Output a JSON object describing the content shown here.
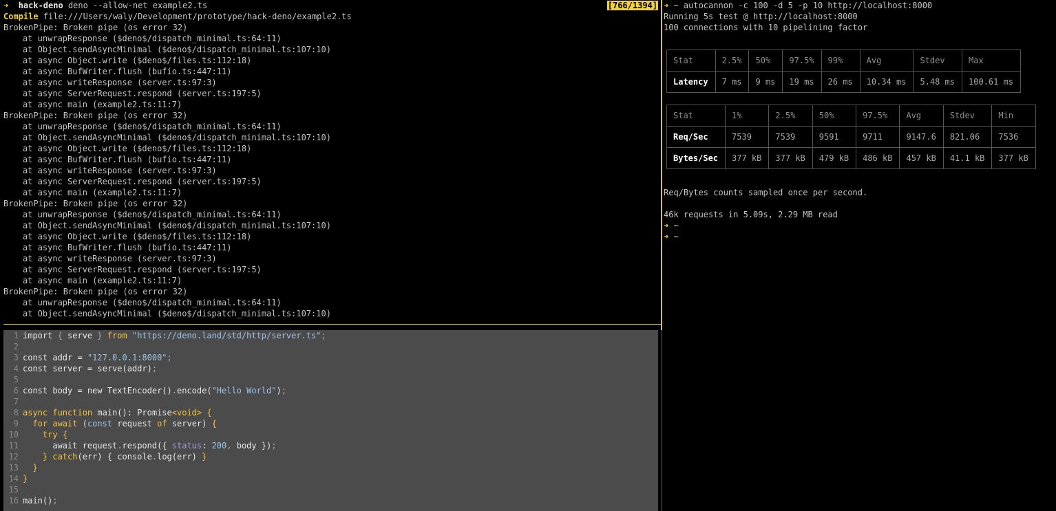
{
  "log_pane": {
    "prompt_symbol": "➜",
    "prompt_dir": "hack-deno",
    "command": "deno --allow-net example2.ts",
    "scroll_position": "[766/1394]",
    "compile_label": "Compile",
    "compile_path": "file:///Users/waly/Development/prototype/hack-deno/example2.ts",
    "lines": [
      {
        "text": "BrokenPipe: Broken pipe (os error 32)",
        "indent": false
      },
      {
        "text": "at unwrapResponse ($deno$/dispatch_minimal.ts:64:11)",
        "indent": true
      },
      {
        "text": "at Object.sendAsyncMinimal ($deno$/dispatch_minimal.ts:107:10)",
        "indent": true
      },
      {
        "text": "at async Object.write ($deno$/files.ts:112:18)",
        "indent": true
      },
      {
        "text": "at async BufWriter.flush (bufio.ts:447:11)",
        "indent": true
      },
      {
        "text": "at async writeResponse (server.ts:97:3)",
        "indent": true
      },
      {
        "text": "at async ServerRequest.respond (server.ts:197:5)",
        "indent": true
      },
      {
        "text": "at async main (example2.ts:11:7)",
        "indent": true
      },
      {
        "text": "BrokenPipe: Broken pipe (os error 32)",
        "indent": false
      },
      {
        "text": "at unwrapResponse ($deno$/dispatch_minimal.ts:64:11)",
        "indent": true
      },
      {
        "text": "at Object.sendAsyncMinimal ($deno$/dispatch_minimal.ts:107:10)",
        "indent": true
      },
      {
        "text": "at async Object.write ($deno$/files.ts:112:18)",
        "indent": true
      },
      {
        "text": "at async BufWriter.flush (bufio.ts:447:11)",
        "indent": true
      },
      {
        "text": "at async writeResponse (server.ts:97:3)",
        "indent": true
      },
      {
        "text": "at async ServerRequest.respond (server.ts:197:5)",
        "indent": true
      },
      {
        "text": "at async main (example2.ts:11:7)",
        "indent": true
      },
      {
        "text": "BrokenPipe: Broken pipe (os error 32)",
        "indent": false
      },
      {
        "text": "at unwrapResponse ($deno$/dispatch_minimal.ts:64:11)",
        "indent": true
      },
      {
        "text": "at Object.sendAsyncMinimal ($deno$/dispatch_minimal.ts:107:10)",
        "indent": true
      },
      {
        "text": "at async Object.write ($deno$/files.ts:112:18)",
        "indent": true
      },
      {
        "text": "at async BufWriter.flush (bufio.ts:447:11)",
        "indent": true
      },
      {
        "text": "at async writeResponse (server.ts:97:3)",
        "indent": true
      },
      {
        "text": "at async ServerRequest.respond (server.ts:197:5)",
        "indent": true
      },
      {
        "text": "at async main (example2.ts:11:7)",
        "indent": true
      },
      {
        "text": "BrokenPipe: Broken pipe (os error 32)",
        "indent": false
      },
      {
        "text": "at unwrapResponse ($deno$/dispatch_minimal.ts:64:11)",
        "indent": true
      },
      {
        "text": "at Object.sendAsyncMinimal ($deno$/dispatch_minimal.ts:107:10)",
        "indent": true
      }
    ]
  },
  "editor": {
    "lines": [
      {
        "n": "1",
        "tokens": [
          [
            "kw0",
            "import "
          ],
          [
            "sym",
            "{ "
          ],
          [
            "code",
            "serve "
          ],
          [
            "sym",
            "} "
          ],
          [
            "kw",
            "from "
          ],
          [
            "str",
            "\"https://deno.land/std/http/server.ts\""
          ],
          [
            "sym",
            ";"
          ]
        ]
      },
      {
        "n": "2",
        "tokens": []
      },
      {
        "n": "3",
        "tokens": [
          [
            "code",
            "const addr = "
          ],
          [
            "str",
            "\"127.0.0.1:8000\""
          ],
          [
            "sym",
            ";"
          ]
        ]
      },
      {
        "n": "4",
        "tokens": [
          [
            "code",
            "const server = serve(addr)"
          ],
          [
            "sym",
            ";"
          ]
        ]
      },
      {
        "n": "5",
        "tokens": []
      },
      {
        "n": "6",
        "tokens": [
          [
            "code",
            "const body = "
          ],
          [
            "code",
            "new "
          ],
          [
            "code",
            "TextEncoder()"
          ],
          [
            "sym",
            "."
          ],
          [
            "code",
            "encode("
          ],
          [
            "str",
            "\"Hello World\""
          ],
          [
            "code",
            ")"
          ],
          [
            "sym",
            ";"
          ]
        ]
      },
      {
        "n": "7",
        "tokens": []
      },
      {
        "n": "8",
        "tokens": [
          [
            "kw",
            "async "
          ],
          [
            "kw",
            "function "
          ],
          [
            "code",
            "main(): Promise"
          ],
          [
            "kw",
            "<void> "
          ],
          [
            "kw",
            "{"
          ]
        ]
      },
      {
        "n": "9",
        "tokens": [
          [
            "code",
            "  "
          ],
          [
            "kw",
            "for "
          ],
          [
            "kw",
            "await "
          ],
          [
            "code",
            "("
          ],
          [
            "str",
            "const "
          ],
          [
            "code",
            "request "
          ],
          [
            "kw",
            "of "
          ],
          [
            "code",
            "server) "
          ],
          [
            "kw",
            "{"
          ]
        ]
      },
      {
        "n": "10",
        "tokens": [
          [
            "code",
            "    "
          ],
          [
            "kw",
            "try "
          ],
          [
            "kw",
            "{"
          ]
        ]
      },
      {
        "n": "11",
        "tokens": [
          [
            "code",
            "      await request"
          ],
          [
            "sym",
            "."
          ],
          [
            "code",
            "respond({ "
          ],
          [
            "prop",
            "status"
          ],
          [
            "code",
            ": "
          ],
          [
            "num",
            "200"
          ],
          [
            "sym",
            ", "
          ],
          [
            "code",
            "body })"
          ],
          [
            "sym",
            ";"
          ]
        ]
      },
      {
        "n": "12",
        "tokens": [
          [
            "code",
            "    "
          ],
          [
            "kw",
            "} "
          ],
          [
            "kw",
            "catch"
          ],
          [
            "code",
            "(err) { console"
          ],
          [
            "sym",
            "."
          ],
          [
            "code",
            "log(err) "
          ],
          [
            "kw",
            "}"
          ]
        ]
      },
      {
        "n": "13",
        "tokens": [
          [
            "code",
            "  "
          ],
          [
            "kw",
            "}"
          ]
        ]
      },
      {
        "n": "14",
        "tokens": [
          [
            "kw",
            "}"
          ]
        ]
      },
      {
        "n": "15",
        "tokens": []
      },
      {
        "n": "16",
        "tokens": [
          [
            "code",
            "main()"
          ],
          [
            "sym",
            ";"
          ]
        ]
      }
    ]
  },
  "bench": {
    "prompt_symbol": "➜",
    "command": " ~ autocannon -c 100 -d 5 -p 10 http://localhost:8000",
    "running": "Running 5s test @ http://localhost:8000",
    "connections": "100 connections with 10 pipelining factor",
    "latency_table": {
      "header": [
        "Stat",
        "2.5%",
        "50%",
        "97.5%",
        "99%",
        "Avg",
        "Stdev",
        "Max"
      ],
      "rows": [
        [
          "Latency",
          "7 ms",
          "9 ms",
          "19 ms",
          "26 ms",
          "10.34 ms",
          "5.48 ms",
          "100.61 ms"
        ]
      ]
    },
    "throughput_table": {
      "header": [
        "Stat",
        "1%",
        "2.5%",
        "50%",
        "97.5%",
        "Avg",
        "Stdev",
        "Min"
      ],
      "rows": [
        [
          "Req/Sec",
          "7539",
          "7539",
          "9591",
          "9711",
          "9147.6",
          "821.06",
          "7536"
        ],
        [
          "Bytes/Sec",
          "377 kB",
          "377 kB",
          "479 kB",
          "486 kB",
          "457 kB",
          "41.1 kB",
          "377 kB"
        ]
      ]
    },
    "sampled_note": "Req/Bytes counts sampled once per second.",
    "summary": "46k requests in 5.09s, 2.29 MB read",
    "prompts": [
      " ~",
      " ~"
    ]
  }
}
